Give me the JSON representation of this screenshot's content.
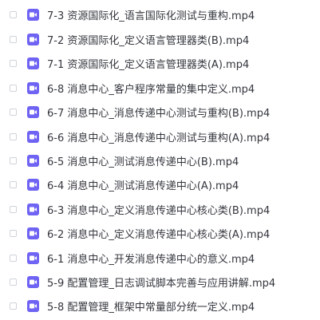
{
  "files": [
    {
      "name": "7-3 资源国际化_语言国际化测试与重构.mp4",
      "icon": "video-file-icon"
    },
    {
      "name": "7-2 资源国际化_定义语言管理器类(B).mp4",
      "icon": "video-file-icon"
    },
    {
      "name": "7-1 资源国际化_定义语言管理器类(A).mp4",
      "icon": "video-file-icon"
    },
    {
      "name": "6-8 消息中心_客户程序常量的集中定义.mp4",
      "icon": "video-file-icon"
    },
    {
      "name": "6-7 消息中心_消息传递中心测试与重构(B).mp4",
      "icon": "video-file-icon"
    },
    {
      "name": "6-6 消息中心_消息传递中心测试与重构(A).mp4",
      "icon": "video-file-icon"
    },
    {
      "name": "6-5 消息中心_测试消息传递中心(B).mp4",
      "icon": "video-file-icon"
    },
    {
      "name": "6-4 消息中心_测试消息传递中心(A).mp4",
      "icon": "video-file-icon"
    },
    {
      "name": "6-3 消息中心_定义消息传递中心核心类(B).mp4",
      "icon": "video-file-icon"
    },
    {
      "name": "6-2 消息中心_定义消息传递中心核心类(A).mp4",
      "icon": "video-file-icon"
    },
    {
      "name": "6-1 消息中心_开发消息传递中心的意义.mp4",
      "icon": "video-file-icon"
    },
    {
      "name": "5-9 配置管理_日志调试脚本完善与应用讲解.mp4",
      "icon": "video-file-icon"
    },
    {
      "name": "5-8 配置管理_框架中常量部分统一定义.mp4",
      "icon": "video-file-icon"
    }
  ],
  "colors": {
    "icon_bg": "#6f63f4",
    "text": "#33363d",
    "checkbox_border": "#cfd3da"
  }
}
